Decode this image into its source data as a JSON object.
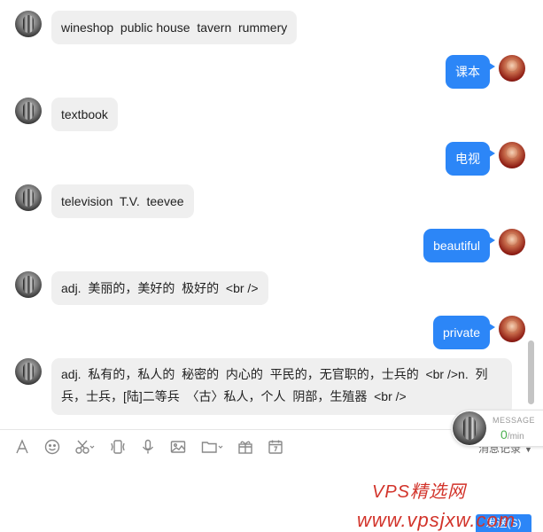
{
  "messages": [
    {
      "side": "in",
      "text": "wineshop  public house  tavern  rummery"
    },
    {
      "side": "out",
      "text": "课本"
    },
    {
      "side": "in",
      "text": "textbook"
    },
    {
      "side": "out",
      "text": "电视"
    },
    {
      "side": "in",
      "text": "television  T.V.  teevee"
    },
    {
      "side": "out",
      "text": "beautiful"
    },
    {
      "side": "in",
      "text": "adj.  美丽的，美好的  极好的  <br />"
    },
    {
      "side": "out",
      "text": "private"
    },
    {
      "side": "in",
      "text": "adj.  私有的，私人的  秘密的  内心的  平民的，无官职的，士兵的  <br />n.  列兵，士兵，[陆]二等兵  〈古〉私人，个人  阴部，生殖器  <br />"
    }
  ],
  "toolbar": {
    "icons": [
      "font-icon",
      "emoji-icon",
      "scissors-icon",
      "shake-icon",
      "microphone-icon",
      "image-icon",
      "folder-icon",
      "gift-icon",
      "calendar-icon"
    ],
    "history_label": "消息记录"
  },
  "speed_widget": {
    "label": "MESSAGE",
    "value": "0",
    "unit": "/min"
  },
  "send_label": "发送(S)",
  "watermark": {
    "line1": "VPS精选网",
    "line2": "www.vpsjxw.com"
  },
  "colors": {
    "outgoing_bubble": "#2c86f7",
    "incoming_bubble": "#efefef",
    "watermark": "#d2332a"
  }
}
